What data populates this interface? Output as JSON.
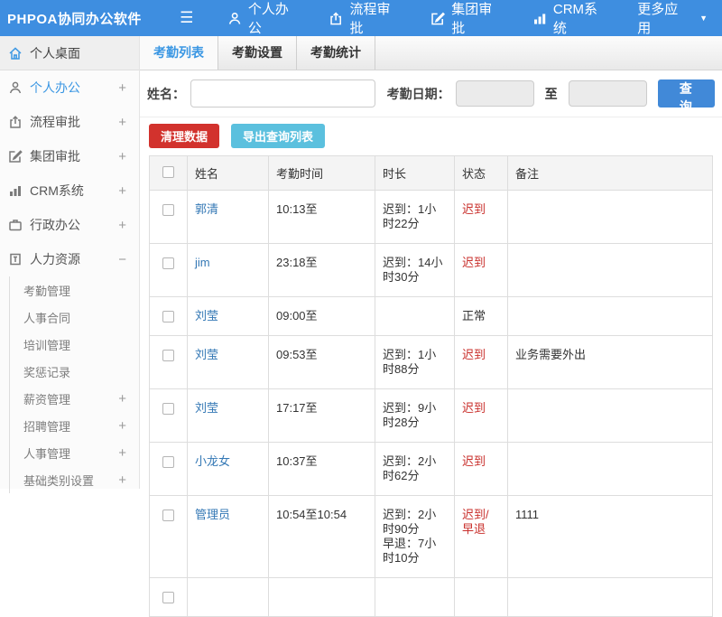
{
  "app": {
    "title": "PHPOA协同办公软件"
  },
  "navbar": {
    "items": [
      {
        "label": "个人办公",
        "icon": "person-icon"
      },
      {
        "label": "流程审批",
        "icon": "workflow-icon"
      },
      {
        "label": "集团审批",
        "icon": "edit-icon"
      },
      {
        "label": "CRM系统",
        "icon": "bar-chart-icon"
      },
      {
        "label": "更多应用",
        "icon": "caret-down-icon"
      }
    ]
  },
  "sidebar": {
    "desktop": {
      "label": "个人桌面",
      "icon": "home-icon"
    },
    "items": [
      {
        "label": "个人办公",
        "icon": "person-icon",
        "expand": "+"
      },
      {
        "label": "流程审批",
        "icon": "workflow-icon",
        "expand": "+"
      },
      {
        "label": "集团审批",
        "icon": "edit-icon",
        "expand": "+"
      },
      {
        "label": "CRM系统",
        "icon": "bar-chart-icon",
        "expand": "+"
      },
      {
        "label": "行政办公",
        "icon": "briefcase-icon",
        "expand": "+"
      },
      {
        "label": "人力资源",
        "icon": "building-icon",
        "expand": "−"
      }
    ],
    "submenu": [
      {
        "label": "考勤管理",
        "expand": ""
      },
      {
        "label": "人事合同",
        "expand": ""
      },
      {
        "label": "培训管理",
        "expand": ""
      },
      {
        "label": "奖惩记录",
        "expand": ""
      },
      {
        "label": "薪资管理",
        "expand": "+"
      },
      {
        "label": "招聘管理",
        "expand": "+"
      },
      {
        "label": "人事管理",
        "expand": "+"
      },
      {
        "label": "基础类别设置",
        "expand": "+"
      }
    ]
  },
  "tabs": [
    {
      "label": "考勤列表"
    },
    {
      "label": "考勤设置"
    },
    {
      "label": "考勤统计"
    }
  ],
  "filter": {
    "name_label": "姓名：",
    "date_label": "考勤日期：",
    "to_label": "至",
    "query_button": "查 询"
  },
  "actions": {
    "clear_button": "清理数据",
    "export_button": "导出查询列表"
  },
  "table": {
    "headers": [
      "姓名",
      "考勤时间",
      "时长",
      "状态",
      "备注"
    ],
    "rows": [
      {
        "name": "郭清",
        "time": "10:13至",
        "duration": "迟到：1小时22分",
        "status": "迟到",
        "remark": ""
      },
      {
        "name": "jim",
        "time": "23:18至",
        "duration": "迟到：14小时30分",
        "status": "迟到",
        "remark": ""
      },
      {
        "name": "刘莹",
        "time": "09:00至",
        "duration": "",
        "status": "正常",
        "remark": ""
      },
      {
        "name": "刘莹",
        "time": "09:53至",
        "duration": "迟到：1小时88分",
        "status": "迟到",
        "remark": "业务需要外出"
      },
      {
        "name": "刘莹",
        "time": "17:17至",
        "duration": "迟到：9小时28分",
        "status": "迟到",
        "remark": ""
      },
      {
        "name": "小龙女",
        "time": "10:37至",
        "duration": "迟到：2小时62分",
        "status": "迟到",
        "remark": ""
      },
      {
        "name": "管理员",
        "time": "10:54至10:54",
        "duration": "迟到：2小时90分\n早退：7小时10分",
        "status": "迟到/早退",
        "remark": "1111"
      }
    ]
  },
  "colors": {
    "navbar_blue": "#3e8ee0",
    "link_blue": "#3478b5",
    "active_blue": "#3b97e3",
    "status_red": "#c9302c",
    "btn_primary": "#4189d8",
    "btn_danger": "#d2322d",
    "btn_info": "#5bc0de"
  }
}
